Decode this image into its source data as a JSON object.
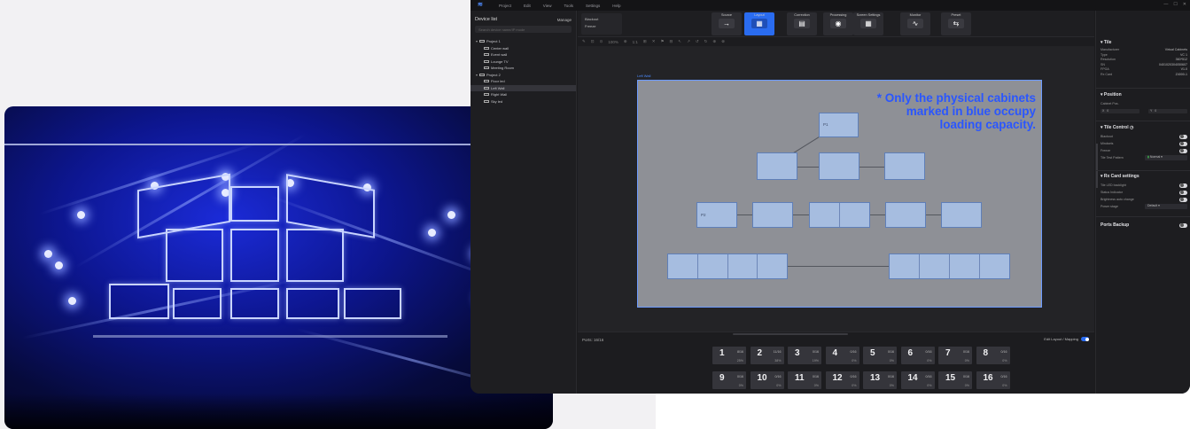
{
  "photo": {
    "alt": "LED stage screens during a concert with blue lighting"
  },
  "app": {
    "menu": [
      "Project",
      "Edit",
      "View",
      "Tools",
      "Settings",
      "Help"
    ],
    "window_controls": [
      "—",
      "☐",
      "✕"
    ],
    "sidebar": {
      "title": "Device list",
      "manage": "Manage",
      "search_placeholder": "Search device name/IP mode",
      "tree": [
        {
          "label": "Project 1",
          "level": 0,
          "selected": false
        },
        {
          "label": "Center wall",
          "level": 1,
          "selected": false
        },
        {
          "label": "Event wall",
          "level": 1,
          "selected": false
        },
        {
          "label": "Lounge TV",
          "level": 1,
          "selected": false
        },
        {
          "label": "Meeting Room",
          "level": 1,
          "selected": false
        },
        {
          "label": "Project 2",
          "level": 0,
          "selected": false
        },
        {
          "label": "Floor led",
          "level": 1,
          "selected": false
        },
        {
          "label": "Left Wall",
          "level": 1,
          "selected": true
        },
        {
          "label": "Right Wall",
          "level": 1,
          "selected": false
        },
        {
          "label": "Sky led",
          "level": 1,
          "selected": false
        }
      ]
    },
    "topleft": [
      "Blackout",
      "Freeze"
    ],
    "tools": [
      {
        "label": "Source",
        "icon": "→",
        "active": false
      },
      {
        "label": "Layout",
        "icon": "▦",
        "active": true
      },
      {
        "label": "Correction",
        "icon": "▤",
        "active": false
      },
      {
        "label": "Processing",
        "icon": "◉",
        "active": false
      },
      {
        "label": "Screen Settings",
        "icon": "▦",
        "active": false
      },
      {
        "label": "Monitor",
        "icon": "∿",
        "active": false
      },
      {
        "label": "Preset",
        "icon": "⇆",
        "active": false
      }
    ],
    "toolbar_row": [
      "✎",
      "⊡",
      "⊙",
      "100%",
      "⊕",
      "1:1",
      "⊞",
      "✕",
      "⚑",
      "⊟",
      "↖",
      "↗",
      "↺",
      "↻",
      "⊕",
      "⊗"
    ],
    "canvas": {
      "wall_label": "Left Wall",
      "note_lines": [
        "* Only the physical cabinets",
        "marked in blue occupy",
        "loading capacity."
      ],
      "cabinet_labels": {
        "p1": "P1",
        "p2": "P2"
      }
    },
    "bottom": {
      "ports_label": "Ports: 16/16",
      "mapping_label": "Edit Layout / Mapping",
      "ports_row1": [
        {
          "n": "1",
          "c": "8/16",
          "p": "25%"
        },
        {
          "n": "2",
          "c": "11/16",
          "p": "38%"
        },
        {
          "n": "3",
          "c": "0/16",
          "p": "19%"
        },
        {
          "n": "4",
          "c": "0/16",
          "p": "0%"
        },
        {
          "n": "5",
          "c": "0/16",
          "p": "0%"
        },
        {
          "n": "6",
          "c": "0/16",
          "p": "0%"
        },
        {
          "n": "7",
          "c": "0/16",
          "p": "0%"
        },
        {
          "n": "8",
          "c": "0/16",
          "p": "0%"
        }
      ],
      "ports_row2": [
        {
          "n": "9",
          "c": "0/16",
          "p": "0%"
        },
        {
          "n": "10",
          "c": "0/16",
          "p": "0%"
        },
        {
          "n": "11",
          "c": "0/16",
          "p": "0%"
        },
        {
          "n": "12",
          "c": "0/16",
          "p": "0%"
        },
        {
          "n": "13",
          "c": "0/16",
          "p": "0%"
        },
        {
          "n": "14",
          "c": "0/16",
          "p": "0%"
        },
        {
          "n": "15",
          "c": "0/16",
          "p": "0%"
        },
        {
          "n": "16",
          "c": "0/16",
          "p": "0%"
        }
      ]
    },
    "right_panel": {
      "tile": {
        "title": "Tile",
        "props": [
          {
            "k": "Manufacturer",
            "v": "Virtual Cabinets"
          },
          {
            "k": "Type",
            "v": "VC 1"
          },
          {
            "k": "Resolution",
            "v": "360*512"
          },
          {
            "k": "SN",
            "v": "0401020304050607"
          },
          {
            "k": "FPGA",
            "v": "V1.0"
          },
          {
            "k": "Rx Card",
            "v": "Z4000-1"
          }
        ]
      },
      "position": {
        "title": "Position",
        "label": "Cabinet Pos.",
        "x_label": "X",
        "x_value": "0",
        "y_label": "Y",
        "y_value": "0"
      },
      "tile_control": {
        "title": "Tile Control",
        "toggles": [
          {
            "label": "Blackout",
            "on": false
          },
          {
            "label": "Mindsets",
            "on": false
          },
          {
            "label": "Freeze",
            "on": false
          }
        ],
        "test_pattern_label": "Tile Test Pattern",
        "test_pattern_value": "Normal"
      },
      "rx_card": {
        "title": "Rx Card settings",
        "toggles": [
          {
            "label": "Tile LED backlight",
            "on": false
          },
          {
            "label": "Status Indicator",
            "on": false
          },
          {
            "label": "Brightness auto change",
            "on": false
          }
        ],
        "mode_label": "Power stage",
        "mode_value": "Default"
      },
      "ports_backup": {
        "title": "Ports Backup",
        "on": false
      }
    }
  },
  "colors": {
    "accent": "#2a6cf0",
    "note": "#2a56ff",
    "cabinet": "#a6bde0",
    "app_bg": "#1b1b1d"
  }
}
